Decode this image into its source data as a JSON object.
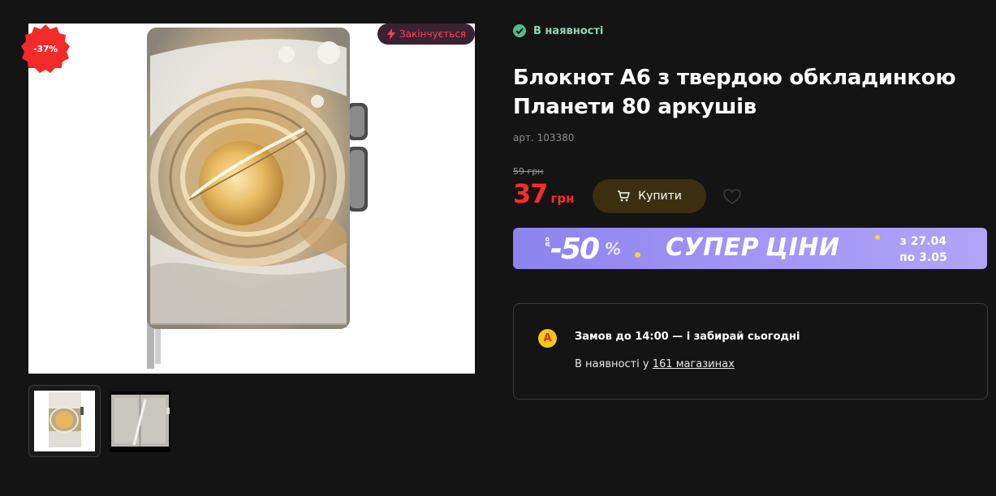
{
  "product": {
    "title": "Блокнот А6 з твердою обкладинкою Планети 80 аркушів",
    "sku": "арт. 103380",
    "stock_status": "В наявності",
    "discount_badge": "-37%",
    "ending_badge": "Закінчується",
    "old_price": "59 грн",
    "price_value": "37",
    "price_currency": "грн"
  },
  "actions": {
    "buy_label": "Купити"
  },
  "promo": {
    "upto": "до",
    "big": "-50",
    "percent": "%",
    "word1": "СУПЕР",
    "word2": "ЦІНИ",
    "date_from": "з 27.04",
    "date_to": "по 3.05"
  },
  "pickup": {
    "logo_letter": "А",
    "order_text": "Замов до 14:00 — і забирай сьогодні",
    "availability_prefix": "В наявності у ",
    "stores_link": "161 магазинах"
  },
  "gallery": {
    "thumbnails": [
      "notebook-cover",
      "notebook-open"
    ]
  },
  "colors": {
    "background": "#141414",
    "price_red": "#ff2b2b",
    "stock_green": "#56b98f",
    "buy_button": "#3b2f10",
    "promo_purple": "#9c90f3"
  }
}
